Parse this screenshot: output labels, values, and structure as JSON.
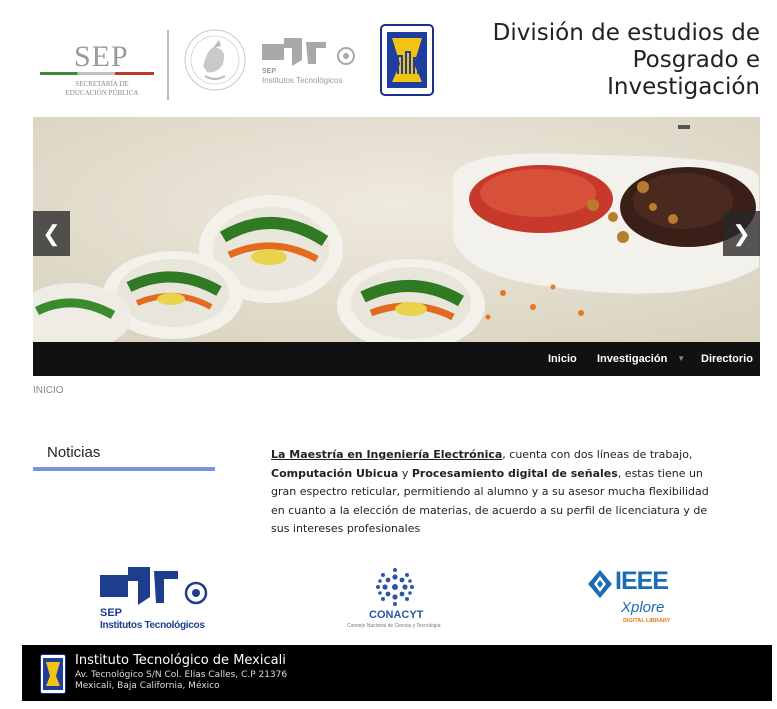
{
  "header": {
    "sep": {
      "word": "SEP",
      "subtitle_line1": "SECRETARÍA DE",
      "subtitle_line2": "EDUCACIÓN PÚBLICA"
    },
    "tecnm_grey": {
      "line1": "SEP",
      "line2": "Institutos Tecnológicos"
    },
    "division_title_line1": "División de estudios de",
    "division_title_line2": "Posgrado e",
    "division_title_line3": "Investigación"
  },
  "slider": {
    "prev_glyph": "❮",
    "next_glyph": "❯"
  },
  "nav": {
    "items": [
      {
        "label": "Inicio"
      },
      {
        "label": "Investigación"
      },
      {
        "label": "Directorio"
      }
    ],
    "caret_glyph": "▼"
  },
  "breadcrumb": "INICIO",
  "news": {
    "title": "Noticias"
  },
  "intro": {
    "link_text": "La Maestría en Ingeniería Electrónica",
    "text1": ", cuenta con dos líneas de trabajo, ",
    "line_a": "Computación Ubicua",
    "text2": " y ",
    "line_b": "Procesamiento digital de señales",
    "text3": ", estas tiene un gran espectro reticular, permitiendo al alumno y a su asesor mucha flexibilidad en cuanto a la elección de materias, de acuerdo a su perfil de licenciatura y de sus intereses profesionales"
  },
  "partners": {
    "sep": {
      "line1": "SEP",
      "line2": "Institutos Tecnológicos"
    },
    "conacyt": {
      "name": "CONACYT",
      "sub": "Consejo Nacional de Ciencia y Tecnología"
    },
    "ieee": {
      "name": "IEEE",
      "product": "Xplore",
      "sub": "DIGITAL LIBRARY"
    }
  },
  "footer": {
    "name": "Instituto Tecnológico de Mexicali",
    "address_line1": "Av. Tecnológico S/N Col. Elías Calles, C.P 21376",
    "address_line2": "Mexicali, Baja California, México"
  },
  "colors": {
    "nav_bg": "#111111",
    "news_underline": "#7b93dc",
    "footer_bg": "#000000",
    "tecnm_blue": "#1d3e8c"
  }
}
